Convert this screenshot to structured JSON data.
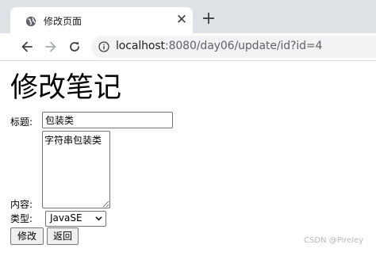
{
  "browser": {
    "tab_title": "修改页面",
    "new_tab_symbol": "+",
    "close_symbol": "✕",
    "url_host": "localhost",
    "url_rest": ":8080/day06/update/id?id=4"
  },
  "page": {
    "heading": "修改笔记",
    "title_label": "标题:",
    "title_value": "包装类",
    "content_label": "内容:",
    "content_value": "字符串包装类",
    "type_label": "类型:",
    "type_selected": "JavaSE",
    "submit_label": "修改",
    "back_label": "返回"
  },
  "watermark": "CSDN @Pireley",
  "icons": {
    "favicon": "globe-icon",
    "back": "arrow-left-icon",
    "forward": "arrow-right-icon",
    "reload": "reload-icon",
    "site_info": "info-icon",
    "select_arrow": "chevron-down-icon"
  }
}
